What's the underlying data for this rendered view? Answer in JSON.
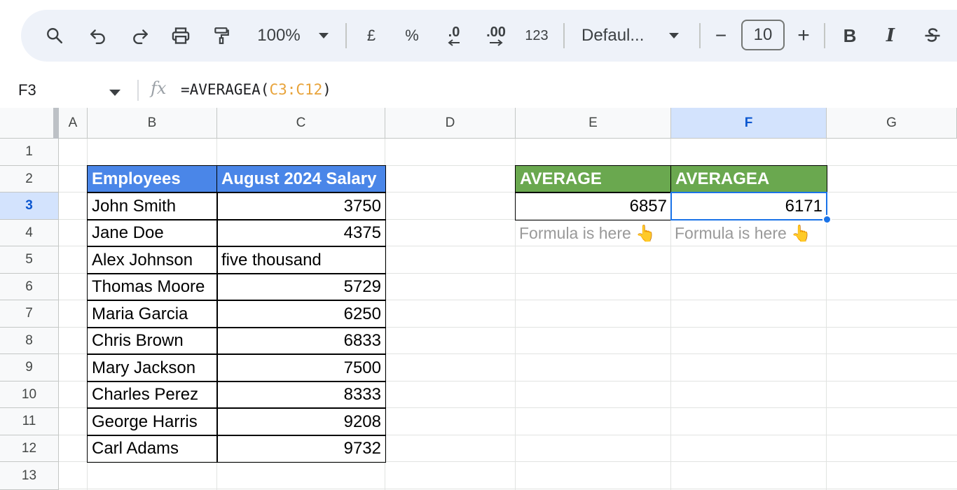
{
  "toolbar": {
    "zoom": "100%",
    "currency_label": "£",
    "percent_label": "%",
    "decrease_decimal_label": ".0",
    "increase_decimal_label": ".00",
    "number_format_label": "123",
    "font_name": "Defaul...",
    "decrease_font_label": "−",
    "font_size": "10",
    "increase_font_label": "+",
    "bold_label": "B",
    "italic_label": "I"
  },
  "formula_bar": {
    "name_box": "F3",
    "fx_label": "fx",
    "formula_prefix": "=AVERAGEA(",
    "formula_range": "C3:C12",
    "formula_suffix": ")"
  },
  "columns": [
    "A",
    "B",
    "C",
    "D",
    "E",
    "F",
    "G"
  ],
  "rows": [
    "1",
    "2",
    "3",
    "4",
    "5",
    "6",
    "7",
    "8",
    "9",
    "10",
    "11",
    "12",
    "13"
  ],
  "selection": {
    "column": "F",
    "row": "3"
  },
  "table": {
    "headers": [
      "Employees",
      "August 2024 Salary"
    ],
    "rows": [
      [
        "John Smith",
        "3750"
      ],
      [
        "Jane Doe",
        "4375"
      ],
      [
        "Alex Johnson",
        "five thousand"
      ],
      [
        "Thomas Moore",
        "5729"
      ],
      [
        "Maria Garcia",
        "6250"
      ],
      [
        "Chris Brown",
        "6833"
      ],
      [
        "Mary Jackson",
        "7500"
      ],
      [
        "Charles Perez",
        "8333"
      ],
      [
        "George Harris",
        "9208"
      ],
      [
        "Carl Adams",
        "9732"
      ]
    ]
  },
  "results": {
    "average_header": "AVERAGE",
    "averagea_header": "AVERAGEA",
    "average_value": "6857",
    "averagea_value": "6171",
    "note_e": "Formula is here 👆",
    "note_f": "Formula is here 👆"
  },
  "colors": {
    "header_blue": "#4a86e8",
    "header_green": "#6aa84f",
    "selection_blue": "#1a73e8",
    "formula_range": "#e8a33a"
  }
}
